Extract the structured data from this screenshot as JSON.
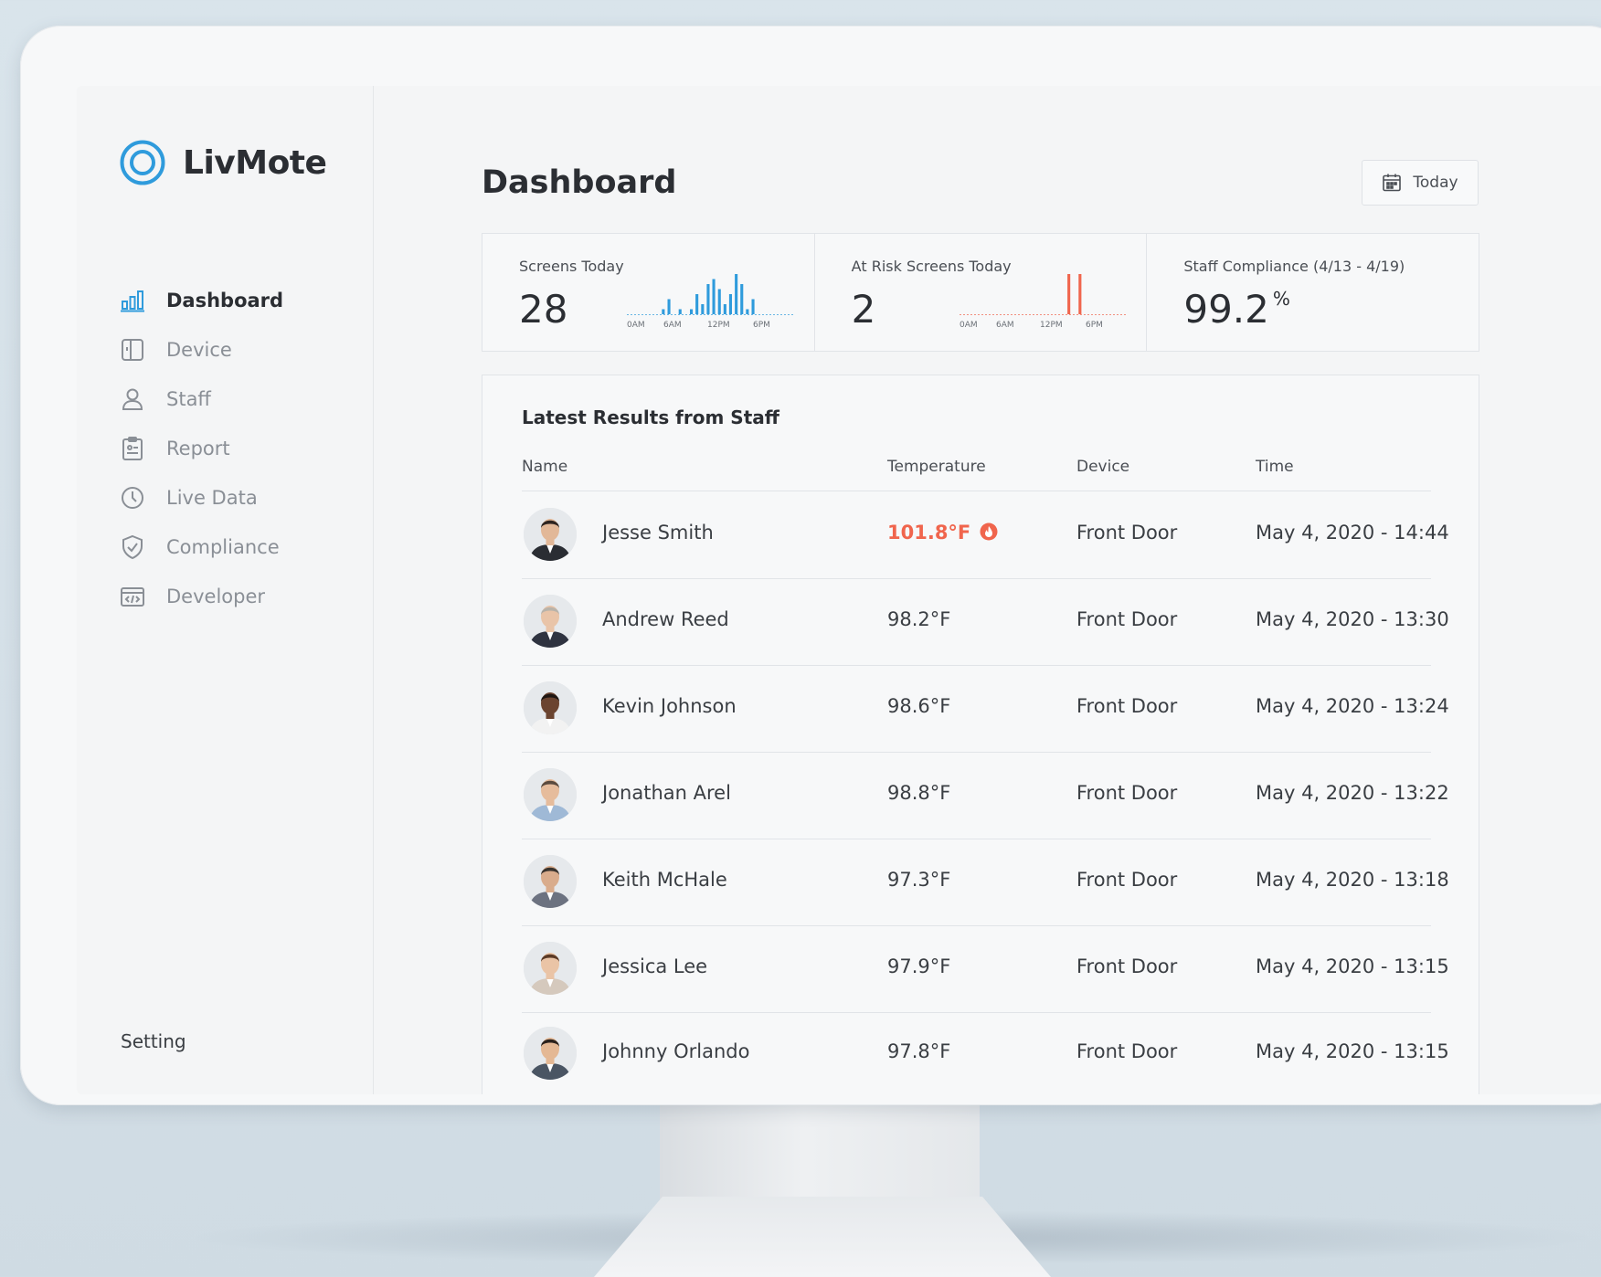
{
  "app": {
    "name": "LivMote"
  },
  "colors": {
    "brand": "#2f9bdc",
    "alert": "#f0654d",
    "text": "#2b2e33",
    "muted": "#8a8f96"
  },
  "sidebar": {
    "items": [
      {
        "label": "Dashboard",
        "icon": "bar-chart-icon",
        "active": true
      },
      {
        "label": "Device",
        "icon": "device-icon",
        "active": false
      },
      {
        "label": "Staff",
        "icon": "user-icon",
        "active": false
      },
      {
        "label": "Report",
        "icon": "clipboard-icon",
        "active": false
      },
      {
        "label": "Live Data",
        "icon": "clock-icon",
        "active": false
      },
      {
        "label": "Compliance",
        "icon": "shield-check-icon",
        "active": false
      },
      {
        "label": "Developer",
        "icon": "code-window-icon",
        "active": false
      }
    ],
    "setting_label": "Setting"
  },
  "header": {
    "title": "Dashboard",
    "date_filter_label": "Today"
  },
  "stats": [
    {
      "label": "Screens Today",
      "value": "28",
      "chart": {
        "type": "bar",
        "color": "#2f9bdc",
        "ticks": [
          "0AM",
          "6AM",
          "12PM",
          "6PM"
        ],
        "values": [
          0,
          0,
          0,
          0,
          0,
          0,
          1,
          3,
          0,
          1,
          0,
          1,
          4,
          2,
          6,
          7,
          5,
          2,
          4,
          8,
          6,
          1,
          3,
          0,
          0,
          0,
          0,
          0,
          0,
          0
        ]
      }
    },
    {
      "label": "At Risk Screens Today",
      "value": "2",
      "chart": {
        "type": "bar",
        "color": "#f0654d",
        "ticks": [
          "0AM",
          "6AM",
          "12PM",
          "6PM"
        ],
        "values": [
          0,
          0,
          0,
          0,
          0,
          0,
          0,
          0,
          0,
          0,
          0,
          0,
          0,
          0,
          0,
          0,
          0,
          0,
          0,
          1,
          0,
          1,
          0,
          0,
          0,
          0,
          0,
          0,
          0,
          0
        ]
      }
    },
    {
      "label": "Staff Compliance (4/13 - 4/19)",
      "value": "99.2",
      "unit": "%"
    }
  ],
  "results": {
    "title": "Latest Results from Staff",
    "columns": [
      "Name",
      "Temperature",
      "Device",
      "Time"
    ],
    "rows": [
      {
        "name": "Jesse Smith",
        "temperature": "101.8°F",
        "alert": true,
        "device": "Front Door",
        "time": "May 4, 2020 - 14:44",
        "skin": "#e2b898",
        "hair": "#2d2420",
        "suit": "#2a2d33"
      },
      {
        "name": "Andrew Reed",
        "temperature": "98.2°F",
        "alert": false,
        "device": "Front Door",
        "time": "May 4, 2020 - 13:30",
        "skin": "#e9c4a8",
        "hair": "#b9b3aa",
        "suit": "#2f3340"
      },
      {
        "name": "Kevin Johnson",
        "temperature": "98.6°F",
        "alert": false,
        "device": "Front Door",
        "time": "May 4, 2020 - 13:24",
        "skin": "#6b4430",
        "hair": "#1e1612",
        "suit": "#f2f2f2"
      },
      {
        "name": "Jonathan Arel",
        "temperature": "98.8°F",
        "alert": false,
        "device": "Front Door",
        "time": "May 4, 2020 - 13:22",
        "skin": "#e6bc9c",
        "hair": "#5a4a3e",
        "suit": "#9fb9d6"
      },
      {
        "name": "Keith McHale",
        "temperature": "97.3°F",
        "alert": false,
        "device": "Front Door",
        "time": "May 4, 2020 - 13:18",
        "skin": "#d9ac8c",
        "hair": "#3a342f",
        "suit": "#6c7280"
      },
      {
        "name": "Jessica Lee",
        "temperature": "97.9°F",
        "alert": false,
        "device": "Front Door",
        "time": "May 4, 2020 - 13:15",
        "skin": "#eac4a6",
        "hair": "#5b3a26",
        "suit": "#d5c9bd"
      },
      {
        "name": "Johnny Orlando",
        "temperature": "97.8°F",
        "alert": false,
        "device": "Front Door",
        "time": "May 4, 2020 - 13:15",
        "skin": "#e4b894",
        "hair": "#2a211c",
        "suit": "#4a5563"
      }
    ]
  }
}
